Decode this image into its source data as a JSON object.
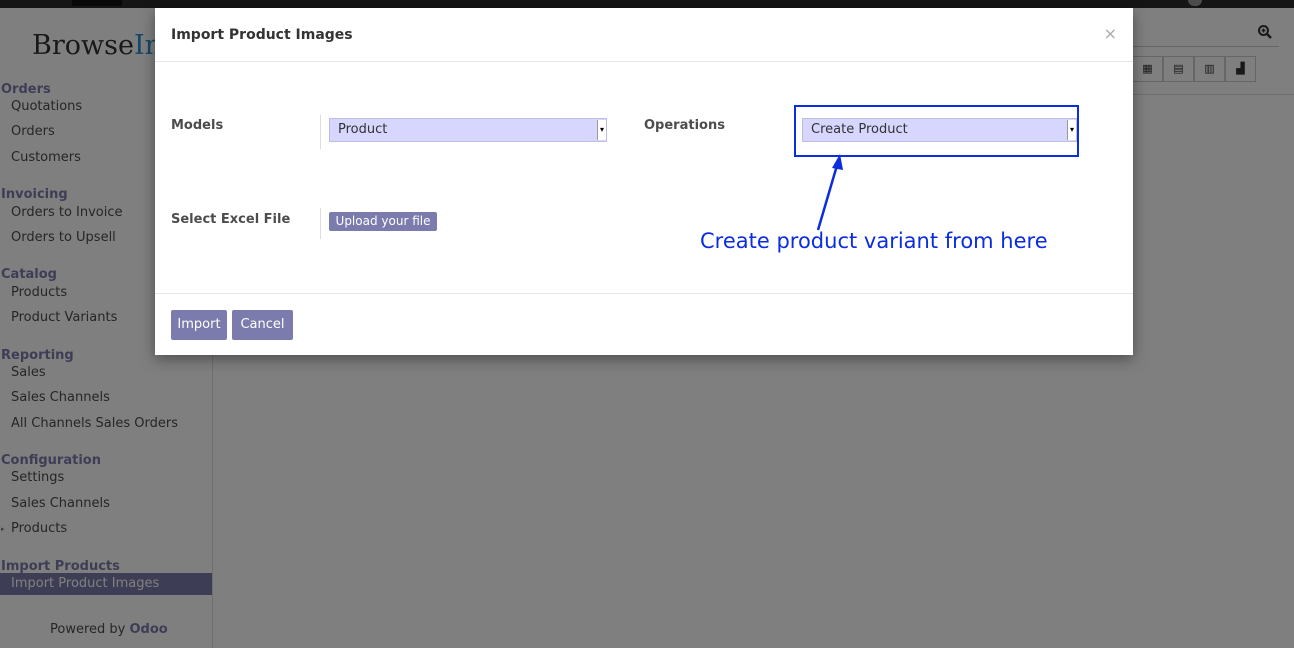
{
  "sidebar": {
    "logo_part1": "Browse",
    "logo_part2": "Inf",
    "sections": [
      {
        "title": "Orders",
        "items": [
          "Quotations",
          "Orders",
          "Customers"
        ]
      },
      {
        "title": "Invoicing",
        "items": [
          "Orders to Invoice",
          "Orders to Upsell"
        ]
      },
      {
        "title": "Catalog",
        "items": [
          "Products",
          "Product Variants"
        ]
      },
      {
        "title": "Reporting",
        "items": [
          "Sales",
          "Sales Channels",
          "All Channels Sales Orders"
        ]
      },
      {
        "title": "Configuration",
        "items": [
          "Settings",
          "Sales Channels",
          "Products"
        ]
      },
      {
        "title": "Import Products",
        "items": [
          "Import Product Images"
        ]
      }
    ],
    "powered_prefix": "Powered by",
    "powered_brand": "Odoo",
    "active_item": "Import Product Images"
  },
  "modal": {
    "title": "Import Product Images",
    "close_glyph": "×",
    "models_label": "Models",
    "models_value": "Product",
    "operations_label": "Operations",
    "operations_value": "Create Product",
    "file_label": "Select Excel File",
    "upload_label": "Upload your file",
    "import_label": "Import",
    "cancel_label": "Cancel"
  },
  "annotation": {
    "text": "Create product variant from here",
    "color": "#0b2de0"
  },
  "colors": {
    "brand": "#7c7bad",
    "select_bg": "#d6d6ff"
  }
}
